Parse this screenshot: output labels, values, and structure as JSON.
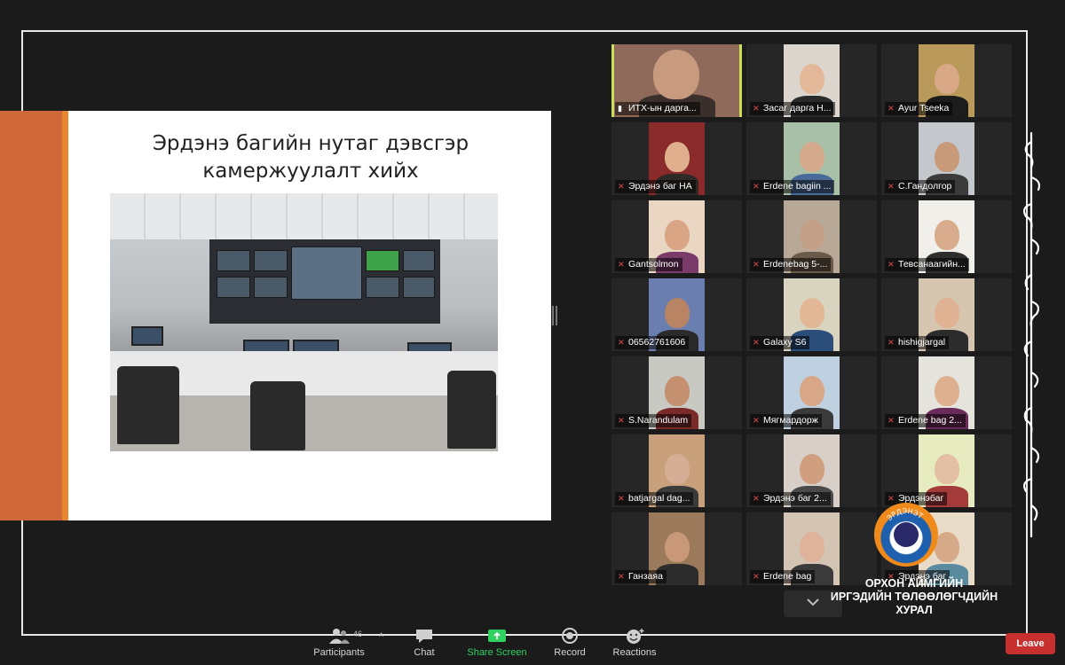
{
  "slide": {
    "title_line1": "Эрдэнэ багийн нутаг дэвсгэр",
    "title_line2": "камержуулалт хийх"
  },
  "participants": [
    {
      "name": "ИТХ-ын дарга...",
      "icon": "pin-icon",
      "active": true
    },
    {
      "name": "Засаг дарга Н...",
      "icon": "mic-muted-icon"
    },
    {
      "name": "Ayur Tseeka",
      "icon": "mic-muted-icon"
    },
    {
      "name": "Эрдэнэ баг НА",
      "icon": "mic-muted-icon"
    },
    {
      "name": "Erdene bagiin ...",
      "icon": "mic-muted-icon"
    },
    {
      "name": "С.Гандолгор",
      "icon": "mic-muted-icon"
    },
    {
      "name": "Gantsolmon",
      "icon": "mic-muted-icon"
    },
    {
      "name": "Erdenebag 5-...",
      "icon": "mic-muted-icon"
    },
    {
      "name": "Тевсанаагийн...",
      "icon": "mic-muted-icon"
    },
    {
      "name": "06562761606",
      "icon": "mic-muted-icon"
    },
    {
      "name": "Galaxy S6",
      "icon": "mic-muted-icon"
    },
    {
      "name": "hishigjargal",
      "icon": "mic-muted-icon"
    },
    {
      "name": "S.Narandulam",
      "icon": "mic-muted-icon"
    },
    {
      "name": "Мягмардорж",
      "icon": "mic-muted-icon"
    },
    {
      "name": "Erdene bag 2...",
      "icon": "mic-muted-icon"
    },
    {
      "name": "batjargal dag...",
      "icon": "mic-muted-icon"
    },
    {
      "name": "Эрдэнэ баг 2...",
      "icon": "mic-muted-icon"
    },
    {
      "name": "Эрдэнэбаг",
      "icon": "mic-muted-icon"
    },
    {
      "name": "Ганзаяа",
      "icon": "mic-muted-icon"
    },
    {
      "name": "Erdene bag",
      "icon": "mic-muted-icon"
    },
    {
      "name": "Эрдэнэ баг",
      "icon": "mic-muted-icon"
    }
  ],
  "watermark": {
    "logo_text": "ЭРДЭНЭТ",
    "line1": "ОРХОН АЙМГИЙН",
    "line2": "ИРГЭДИЙН ТӨЛӨӨЛӨГЧДИЙН",
    "line3": "ХУРАЛ"
  },
  "toolbar": {
    "participants_label": "Participants",
    "participants_count": "46",
    "chat_label": "Chat",
    "share_label": "Share Screen",
    "record_label": "Record",
    "reactions_label": "Reactions",
    "leave_label": "Leave",
    "share_color": "#2fd160",
    "leave_color": "#c82f2f"
  },
  "colors": {
    "active_speaker": "#c9df55",
    "slide_accent": "#d0693a"
  }
}
